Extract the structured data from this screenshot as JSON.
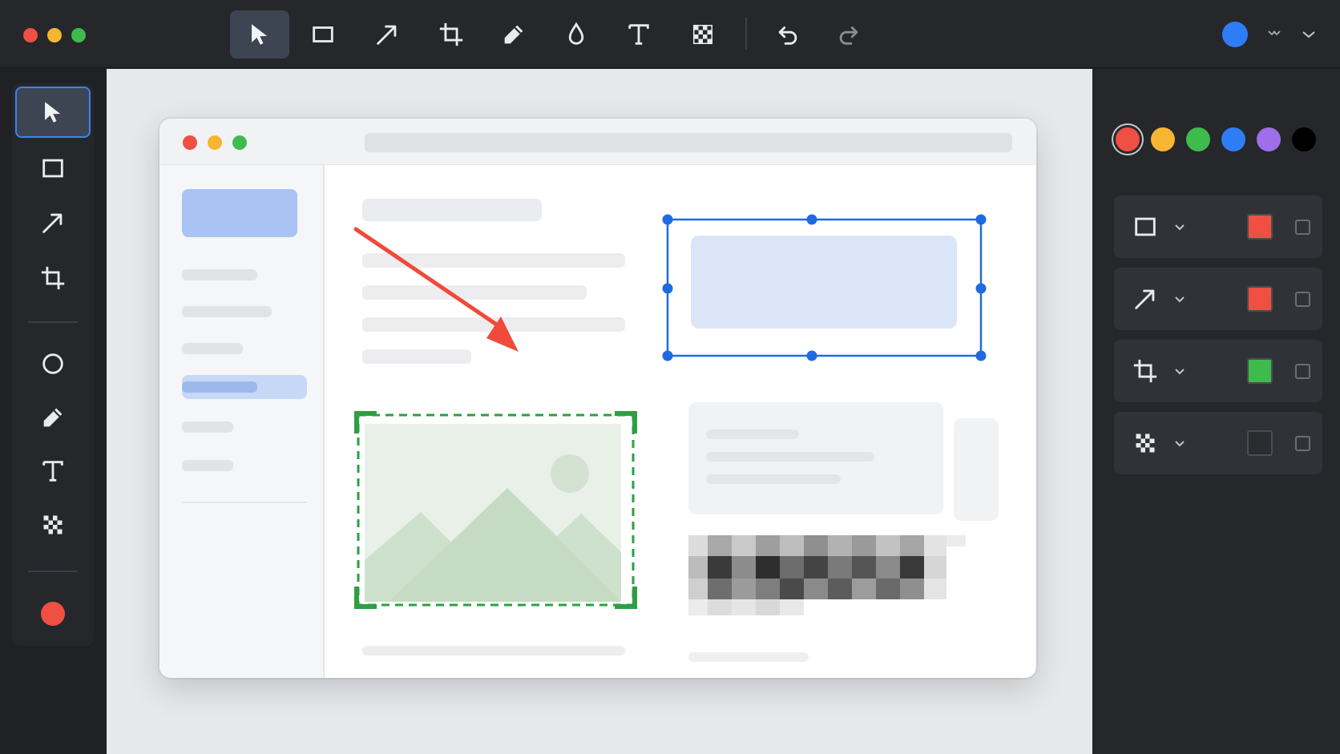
{
  "top_toolbar": {
    "tools": [
      {
        "name": "select-tool",
        "icon": "cursor-icon",
        "active": true
      },
      {
        "name": "rectangle-tool",
        "icon": "rectangle-icon",
        "active": false
      },
      {
        "name": "arrow-tool",
        "icon": "arrow-icon",
        "active": false
      },
      {
        "name": "crop-tool",
        "icon": "crop-icon",
        "active": false
      },
      {
        "name": "pen-tool",
        "icon": "pen-icon",
        "active": false
      },
      {
        "name": "blur-tool",
        "icon": "droplet-icon",
        "active": false
      },
      {
        "name": "text-tool",
        "icon": "text-icon",
        "active": false
      },
      {
        "name": "pixelate-tool",
        "icon": "checkerboard-icon",
        "active": false
      },
      {
        "name": "undo-button",
        "icon": "undo-icon",
        "active": false
      },
      {
        "name": "redo-button",
        "icon": "redo-icon",
        "active": false
      }
    ],
    "current_color": "#2f7df6"
  },
  "left_rail": {
    "tools": [
      "cursor-icon",
      "rectangle-icon",
      "arrow-icon",
      "crop-icon",
      "circle-icon",
      "pen-icon",
      "text-icon",
      "checkerboard-icon"
    ],
    "active_tool": "cursor-icon",
    "current_color": "#f04f43"
  },
  "palette": {
    "colors": [
      "#f04f43",
      "#f6b632",
      "#3fbb4d",
      "#2f7df6",
      "#a06ee8",
      "#000000"
    ],
    "selected": "#f04f43"
  },
  "annotation_props": [
    {
      "tool": "rectangle-icon",
      "color": "#f04f43",
      "checked": false
    },
    {
      "tool": "arrow-icon",
      "color": "#f04f43",
      "checked": false
    },
    {
      "tool": "crop-icon",
      "color": "#3fbb4d",
      "checked": false
    },
    {
      "tool": "checkerboard-icon",
      "color": "#2a2c30",
      "checked": false
    }
  ],
  "accent_colors": {
    "selection": "#1f6ae0",
    "crop_frame": "#2f9e44",
    "arrow": "#ef4a3a"
  }
}
